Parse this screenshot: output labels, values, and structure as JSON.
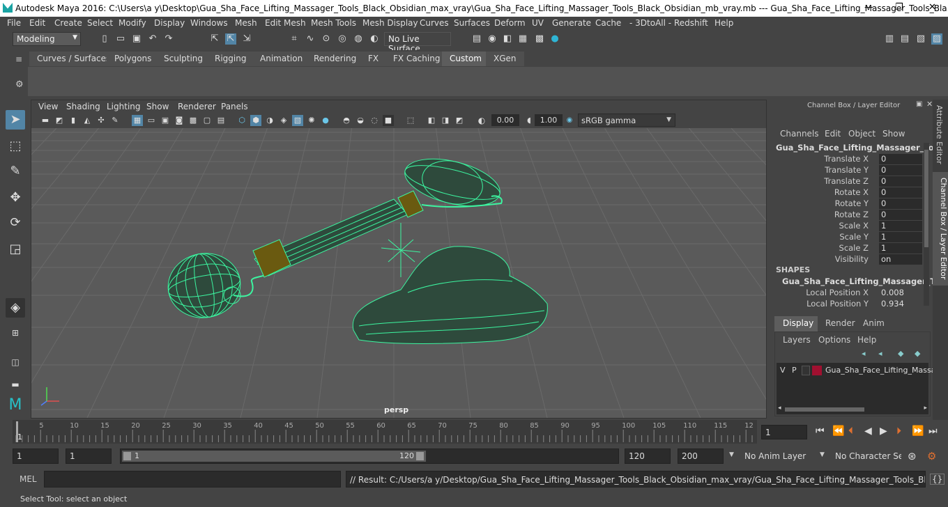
{
  "window": {
    "title": "Autodesk Maya 2016: C:\\Users\\a y\\Desktop\\Gua_Sha_Face_Lifting_Massager_Tools_Black_Obsidian_max_vray\\Gua_Sha_Face_Lifting_Massager_Tools_Black_Obsidian_mb_vray.mb   ---   Gua_Sha_Face_Lifting_Massager_Tools_Bla...",
    "minimize": "—",
    "maximize": "❐",
    "close": "✕"
  },
  "menubar": {
    "items": [
      "File",
      "Edit",
      "Create",
      "Select",
      "Modify",
      "Display",
      "Windows",
      "Mesh",
      "Edit Mesh",
      "Mesh Tools",
      "Mesh Display",
      "Curves",
      "Surfaces",
      "Deform",
      "UV",
      "Generate",
      "Cache",
      "- 3DtoAll -",
      "Redshift",
      "Help"
    ]
  },
  "statusline": {
    "mode": "Modeling",
    "live_surface": "No Live Surface"
  },
  "shelf": {
    "tabs": [
      "Curves / Surfaces",
      "Polygons",
      "Sculpting",
      "Rigging",
      "Animation",
      "Rendering",
      "FX",
      "FX Caching",
      "Custom",
      "XGen"
    ],
    "active_tab": "Custom"
  },
  "viewport": {
    "menu": [
      "View",
      "Shading",
      "Lighting",
      "Show",
      "Renderer",
      "Panels"
    ],
    "exposure": "0.00",
    "gamma": "1.00",
    "color_space": "sRGB gamma",
    "camera_label": "persp",
    "wire_color": "#3cf5a0",
    "grid_color": "#6a6a6a"
  },
  "channel_box": {
    "header": "Channel Box / Layer Editor",
    "menu": [
      "Channels",
      "Edit",
      "Object",
      "Show"
    ],
    "object_name": "Gua_Sha_Face_Lifting_Massager_Tool...",
    "channels": [
      {
        "label": "Translate X",
        "value": "0"
      },
      {
        "label": "Translate Y",
        "value": "0"
      },
      {
        "label": "Translate Z",
        "value": "0"
      },
      {
        "label": "Rotate X",
        "value": "0"
      },
      {
        "label": "Rotate Y",
        "value": "0"
      },
      {
        "label": "Rotate Z",
        "value": "0"
      },
      {
        "label": "Scale X",
        "value": "1"
      },
      {
        "label": "Scale Y",
        "value": "1"
      },
      {
        "label": "Scale Z",
        "value": "1"
      },
      {
        "label": "Visibility",
        "value": "on"
      }
    ],
    "shapes_header": "SHAPES",
    "shape_name": "Gua_Sha_Face_Lifting_Massager_To...",
    "shape_channels": [
      {
        "label": "Local Position X",
        "value": "0.008"
      },
      {
        "label": "Local Position Y",
        "value": "0.934"
      }
    ]
  },
  "layer_editor": {
    "tabs": [
      "Display",
      "Render",
      "Anim"
    ],
    "active_tab": "Display",
    "menu": [
      "Layers",
      "Options",
      "Help"
    ],
    "layer": {
      "v": "V",
      "p": "P",
      "name": "Gua_Sha_Face_Lifting_Massa",
      "color": "#a01030"
    }
  },
  "side_tabs": [
    "Attribute Editor",
    "Channel Box / Layer Editor"
  ],
  "timeline": {
    "ticks": [
      "5",
      "10",
      "15",
      "20",
      "25",
      "30",
      "35",
      "40",
      "45",
      "50",
      "55",
      "60",
      "65",
      "70",
      "75",
      "80",
      "85",
      "90",
      "95",
      "100",
      "105",
      "110",
      "115",
      "12"
    ],
    "start_marker": "1",
    "current_frame": "1"
  },
  "range": {
    "start": "1",
    "playback_start": "1",
    "slider_start": "1",
    "slider_end": "120",
    "playback_end": "120",
    "end": "200",
    "anim_layer": "No Anim Layer",
    "character_set": "No Character Set"
  },
  "command": {
    "mel_label": "MEL",
    "result": "// Result: C:/Users/a y/Desktop/Gua_Sha_Face_Lifting_Massager_Tools_Black_Obsidian_max_vray/Gua_Sha_Face_Lifting_Massager_Tools_Black_Obsidian_mb_vray."
  },
  "help_line": "Select Tool: select an object"
}
